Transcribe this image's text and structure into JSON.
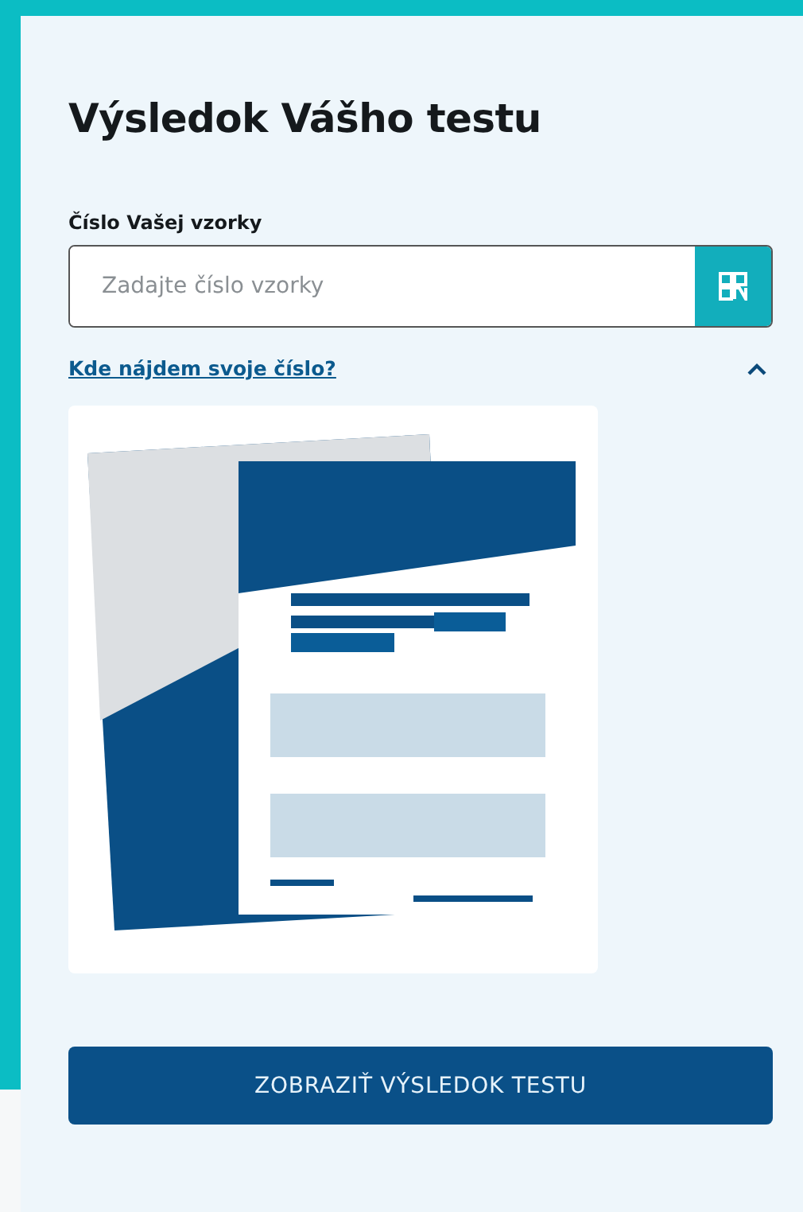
{
  "title": "Výsledok Vášho testu",
  "sample_field": {
    "label": "Číslo Vašej vzorky",
    "placeholder": "Zadajte číslo vzorky"
  },
  "help": {
    "link": "Kde nájdem svoje číslo?",
    "expanded": true
  },
  "submit_button": "ZOBRAZIŤ VÝSLEDOK TESTU"
}
